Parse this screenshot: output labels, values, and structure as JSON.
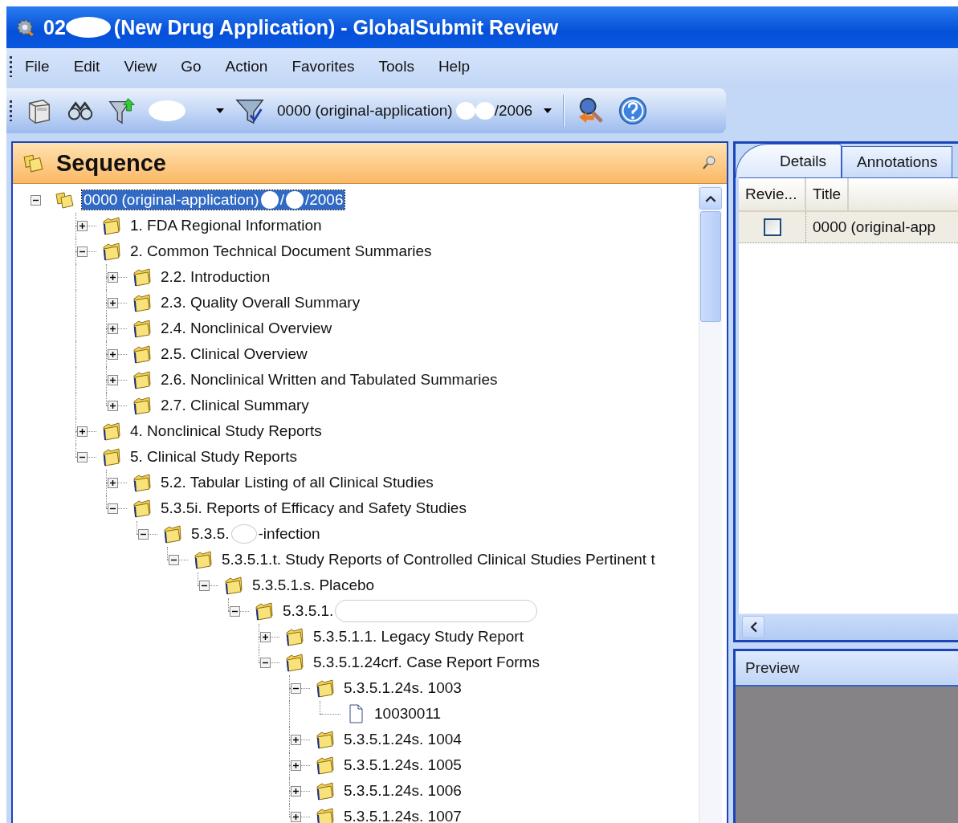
{
  "window": {
    "title_parts": [
      {
        "kind": "text",
        "text": "02"
      },
      {
        "kind": "redaction"
      },
      {
        "kind": "text",
        "text": "(New Drug Application) - GlobalSubmit Review"
      }
    ]
  },
  "menu": [
    {
      "label": "File"
    },
    {
      "label": "Edit"
    },
    {
      "label": "View"
    },
    {
      "label": "Go"
    },
    {
      "label": "Action"
    },
    {
      "label": "Favorites"
    },
    {
      "label": "Tools"
    },
    {
      "label": "Help"
    }
  ],
  "toolbar": {
    "filter_combo": {
      "parts": [
        {
          "kind": "redaction"
        }
      ]
    },
    "sequence_combo": {
      "parts": [
        {
          "kind": "text",
          "text": "0000 (original-application)"
        },
        {
          "kind": "redaction"
        },
        {
          "kind": "redaction"
        },
        {
          "kind": "text",
          "text": "/2006"
        }
      ]
    }
  },
  "sequence_panel": {
    "title": "Sequence",
    "tree": [
      {
        "kind": "sequence",
        "expanded": true,
        "selected": true,
        "parts": [
          {
            "kind": "text",
            "text": "0000 (original-application)"
          },
          {
            "kind": "redaction"
          },
          {
            "kind": "text",
            "text": "/"
          },
          {
            "kind": "redaction"
          },
          {
            "kind": "text",
            "text": "/2006"
          }
        ],
        "children": [
          {
            "kind": "folder",
            "expanded": false,
            "selected": false,
            "parts": [
              {
                "kind": "text",
                "text": "1. FDA Regional Information"
              }
            ]
          },
          {
            "kind": "folder",
            "expanded": true,
            "selected": false,
            "parts": [
              {
                "kind": "text",
                "text": "2. Common Technical Document Summaries"
              }
            ],
            "children": [
              {
                "kind": "folder",
                "expanded": false,
                "selected": false,
                "parts": [
                  {
                    "kind": "text",
                    "text": "2.2. Introduction"
                  }
                ]
              },
              {
                "kind": "folder",
                "expanded": false,
                "selected": false,
                "parts": [
                  {
                    "kind": "text",
                    "text": "2.3. Quality Overall Summary"
                  }
                ]
              },
              {
                "kind": "folder",
                "expanded": false,
                "selected": false,
                "parts": [
                  {
                    "kind": "text",
                    "text": "2.4. Nonclinical Overview"
                  }
                ]
              },
              {
                "kind": "folder",
                "expanded": false,
                "selected": false,
                "parts": [
                  {
                    "kind": "text",
                    "text": "2.5. Clinical Overview"
                  }
                ]
              },
              {
                "kind": "folder",
                "expanded": false,
                "selected": false,
                "parts": [
                  {
                    "kind": "text",
                    "text": "2.6. Nonclinical Written and Tabulated Summaries"
                  }
                ]
              },
              {
                "kind": "folder",
                "expanded": false,
                "selected": false,
                "parts": [
                  {
                    "kind": "text",
                    "text": "2.7. Clinical Summary"
                  }
                ]
              }
            ]
          },
          {
            "kind": "folder",
            "expanded": false,
            "selected": false,
            "parts": [
              {
                "kind": "text",
                "text": "4. Nonclinical Study Reports"
              }
            ]
          },
          {
            "kind": "folder",
            "expanded": true,
            "selected": false,
            "parts": [
              {
                "kind": "text",
                "text": "5. Clinical Study Reports"
              }
            ],
            "children": [
              {
                "kind": "folder",
                "expanded": false,
                "selected": false,
                "parts": [
                  {
                    "kind": "text",
                    "text": "5.2. Tabular Listing of all Clinical Studies"
                  }
                ]
              },
              {
                "kind": "folder",
                "expanded": true,
                "selected": false,
                "parts": [
                  {
                    "kind": "text",
                    "text": "5.3.5i. Reports of Efficacy and Safety Studies"
                  }
                ],
                "children": [
                  {
                    "kind": "folder",
                    "expanded": true,
                    "selected": false,
                    "parts": [
                      {
                        "kind": "text",
                        "text": "5.3.5."
                      },
                      {
                        "kind": "redaction"
                      },
                      {
                        "kind": "text",
                        "text": "-infection"
                      }
                    ],
                    "children": [
                      {
                        "kind": "folder",
                        "expanded": true,
                        "selected": false,
                        "parts": [
                          {
                            "kind": "text",
                            "text": "5.3.5.1.t. Study Reports of Controlled Clinical Studies Pertinent t"
                          }
                        ],
                        "children": [
                          {
                            "kind": "folder",
                            "expanded": true,
                            "selected": false,
                            "parts": [
                              {
                                "kind": "text",
                                "text": "5.3.5.1.s. Placebo"
                              }
                            ],
                            "children": [
                              {
                                "kind": "folder",
                                "expanded": true,
                                "selected": false,
                                "parts": [
                                  {
                                    "kind": "text",
                                    "text": "5.3.5.1."
                                  },
                                  {
                                    "kind": "redaction",
                                    "wide": true
                                  }
                                ],
                                "children": [
                                  {
                                    "kind": "folder",
                                    "expanded": false,
                                    "selected": false,
                                    "parts": [
                                      {
                                        "kind": "text",
                                        "text": "5.3.5.1.1. Legacy Study Report"
                                      }
                                    ]
                                  },
                                  {
                                    "kind": "folder",
                                    "expanded": true,
                                    "selected": false,
                                    "parts": [
                                      {
                                        "kind": "text",
                                        "text": "5.3.5.1.24crf. Case Report Forms"
                                      }
                                    ],
                                    "children": [
                                      {
                                        "kind": "folder",
                                        "expanded": true,
                                        "selected": false,
                                        "parts": [
                                          {
                                            "kind": "text",
                                            "text": "5.3.5.1.24s. 1003"
                                          }
                                        ],
                                        "children": [
                                          {
                                            "kind": "document",
                                            "selected": false,
                                            "parts": [
                                              {
                                                "kind": "text",
                                                "text": "10030011"
                                              }
                                            ]
                                          }
                                        ]
                                      },
                                      {
                                        "kind": "folder",
                                        "expanded": false,
                                        "selected": false,
                                        "parts": [
                                          {
                                            "kind": "text",
                                            "text": "5.3.5.1.24s. 1004"
                                          }
                                        ]
                                      },
                                      {
                                        "kind": "folder",
                                        "expanded": false,
                                        "selected": false,
                                        "parts": [
                                          {
                                            "kind": "text",
                                            "text": "5.3.5.1.24s. 1005"
                                          }
                                        ]
                                      },
                                      {
                                        "kind": "folder",
                                        "expanded": false,
                                        "selected": false,
                                        "parts": [
                                          {
                                            "kind": "text",
                                            "text": "5.3.5.1.24s. 1006"
                                          }
                                        ]
                                      },
                                      {
                                        "kind": "folder",
                                        "expanded": false,
                                        "selected": false,
                                        "parts": [
                                          {
                                            "kind": "text",
                                            "text": "5.3.5.1.24s. 1007"
                                          }
                                        ]
                                      }
                                    ]
                                  }
                                ]
                              }
                            ]
                          }
                        ]
                      }
                    ]
                  }
                ]
              }
            ]
          }
        ]
      }
    ]
  },
  "details_panel": {
    "tabs": [
      {
        "label": "Details",
        "selected": true
      },
      {
        "label": "Annotations",
        "selected": false
      }
    ],
    "columns": [
      "Revie...",
      "Title"
    ],
    "rows": [
      {
        "checked": false,
        "title": "0000 (original-app"
      }
    ]
  },
  "preview_panel": {
    "title": "Preview"
  }
}
